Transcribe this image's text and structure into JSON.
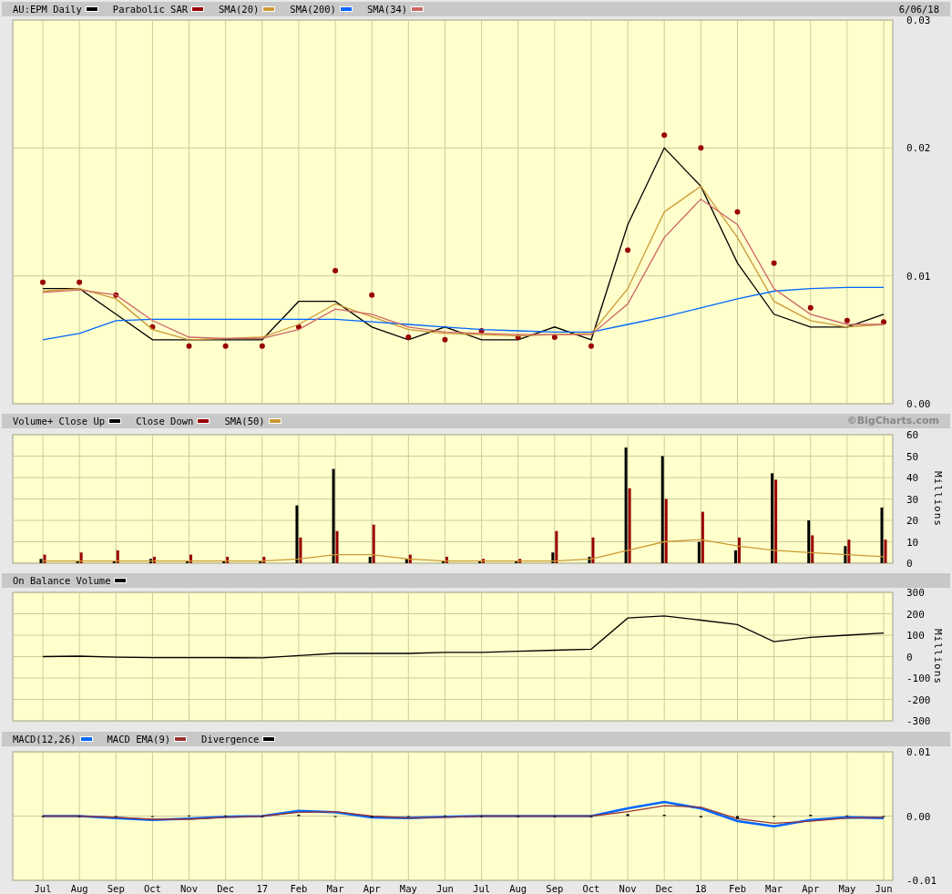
{
  "panels": [
    {
      "header_right": "6/06/18",
      "chart_data": {
        "type": "line",
        "grid": true,
        "ylim": [
          0,
          0.03
        ],
        "yticks": [
          {
            "value": 0,
            "label": "0.00"
          },
          {
            "value": 0.01,
            "label": "0.01"
          },
          {
            "value": 0.02,
            "label": "0.02"
          },
          {
            "value": 0.03,
            "label": "0.03"
          }
        ],
        "series": [
          {
            "name": "AU:EPM Daily",
            "color": "#000000",
            "values": [
              0.009,
              0.009,
              0.007,
              0.005,
              0.005,
              0.005,
              0.005,
              0.008,
              0.008,
              0.006,
              0.005,
              0.006,
              0.005,
              0.005,
              0.006,
              0.005,
              0.014,
              0.02,
              0.017,
              0.011,
              0.007,
              0.006,
              0.006,
              0.007
            ]
          },
          {
            "name": "Parabolic SAR",
            "color": "#990000",
            "type": "scatter",
            "values": [
              0.0095,
              0.0095,
              0.0085,
              0.006,
              0.0045,
              0.0045,
              0.0045,
              0.006,
              0.0104,
              0.0085,
              0.0052,
              0.005,
              0.0057,
              0.0052,
              0.0052,
              0.0045,
              0.012,
              0.021,
              0.02,
              0.015,
              0.011,
              0.0075,
              0.0065,
              0.0064
            ]
          },
          {
            "name": "SMA(20)",
            "color": "#cc9933",
            "values": [
              0.0088,
              0.009,
              0.0082,
              0.0058,
              0.005,
              0.0051,
              0.0052,
              0.0062,
              0.0078,
              0.0068,
              0.0058,
              0.0055,
              0.0054,
              0.0053,
              0.0054,
              0.0055,
              0.009,
              0.015,
              0.017,
              0.013,
              0.008,
              0.0065,
              0.006,
              0.0062
            ]
          },
          {
            "name": "SMA(200)",
            "color": "#0066ff",
            "values": [
              0.005,
              0.0055,
              0.0065,
              0.0066,
              0.0066,
              0.0066,
              0.0066,
              0.0066,
              0.0066,
              0.0064,
              0.0062,
              0.006,
              0.0058,
              0.0057,
              0.0056,
              0.0056,
              0.0062,
              0.0068,
              0.0075,
              0.0082,
              0.0088,
              0.009,
              0.0091,
              0.0091
            ]
          },
          {
            "name": "SMA(34)",
            "color": "#cc6666",
            "values": [
              0.0087,
              0.0089,
              0.0085,
              0.0065,
              0.0052,
              0.0051,
              0.0051,
              0.0058,
              0.0074,
              0.007,
              0.006,
              0.0056,
              0.0055,
              0.0054,
              0.0054,
              0.0054,
              0.0078,
              0.013,
              0.016,
              0.014,
              0.009,
              0.007,
              0.0062,
              0.0062
            ]
          }
        ]
      }
    },
    {
      "header_right": "©BigCharts.com",
      "chart_data": {
        "type": "bar",
        "grid": true,
        "ylabel": "Millions",
        "ylim": [
          0,
          60
        ],
        "yticks": [
          {
            "value": 0,
            "label": "0"
          },
          {
            "value": 10,
            "label": "10"
          },
          {
            "value": 20,
            "label": "20"
          },
          {
            "value": 30,
            "label": "30"
          },
          {
            "value": 40,
            "label": "40"
          },
          {
            "value": 50,
            "label": "50"
          },
          {
            "value": 60,
            "label": "60"
          }
        ],
        "series": [
          {
            "name": "Volume+ Close Up",
            "color": "#000000",
            "values": [
              2,
              1,
              1,
              2,
              1,
              1,
              1,
              27,
              44,
              3,
              2,
              1,
              1,
              1,
              5,
              3,
              54,
              50,
              10,
              6,
              42,
              20,
              8,
              26
            ]
          },
          {
            "name": "Close Down",
            "color": "#990000",
            "values": [
              4,
              5,
              6,
              3,
              4,
              3,
              3,
              12,
              15,
              18,
              4,
              3,
              2,
              2,
              15,
              12,
              35,
              30,
              24,
              12,
              39,
              13,
              11,
              11
            ]
          },
          {
            "name": "SMA(50)",
            "color": "#cc9933",
            "type": "line",
            "values": [
              1,
              1,
              1,
              1,
              1,
              1,
              1,
              2,
              4,
              4,
              2,
              1,
              1,
              1,
              1,
              2,
              6,
              10,
              11,
              8,
              6,
              5,
              4,
              3
            ]
          }
        ]
      }
    },
    {
      "chart_data": {
        "type": "line",
        "grid": true,
        "ylabel": "Millions",
        "ylim": [
          -300,
          300
        ],
        "yticks": [
          {
            "value": 300,
            "label": "300"
          },
          {
            "value": 200,
            "label": "200"
          },
          {
            "value": 100,
            "label": "100"
          },
          {
            "value": 0,
            "label": "0"
          },
          {
            "value": -100,
            "label": "-100"
          },
          {
            "value": -200,
            "label": "-200"
          },
          {
            "value": -300,
            "label": "-300"
          }
        ],
        "series": [
          {
            "name": "On Balance Volume",
            "color": "#000000",
            "values": [
              0,
              2,
              -3,
              -5,
              -5,
              -5,
              -6,
              5,
              15,
              15,
              15,
              20,
              20,
              25,
              30,
              35,
              180,
              190,
              170,
              150,
              70,
              90,
              100,
              110
            ]
          }
        ]
      }
    },
    {
      "chart_data": {
        "type": "line",
        "grid": true,
        "categories": [
          "Jul",
          "Aug",
          "Sep",
          "Oct",
          "Nov",
          "Dec",
          "17",
          "Feb",
          "Mar",
          "Apr",
          "May",
          "Jun",
          "Jul",
          "Aug",
          "Sep",
          "Oct",
          "Nov",
          "Dec",
          "18",
          "Feb",
          "Mar",
          "Apr",
          "May",
          "Jun"
        ],
        "ylim": [
          -0.01,
          0.01
        ],
        "yticks": [
          {
            "value": 0.01,
            "label": "0.01"
          },
          {
            "value": 0,
            "label": "0.00"
          },
          {
            "value": -0.01,
            "label": "-0.01"
          }
        ],
        "series": [
          {
            "name": "MACD(12,26)",
            "color": "#0066ff",
            "values": [
              0,
              0,
              -0.0003,
              -0.0006,
              -0.0004,
              -0.0001,
              0,
              0.0008,
              0.0006,
              -0.0002,
              -0.0003,
              -0.0001,
              0,
              0,
              0,
              0,
              0.0012,
              0.0022,
              0.0012,
              -0.0008,
              -0.0016,
              -0.0006,
              -0.0002,
              -0.0003
            ]
          },
          {
            "name": "MACD EMA(9)",
            "color": "#993333",
            "values": [
              0,
              0,
              -0.0002,
              -0.0005,
              -0.0005,
              -0.0002,
              0,
              0.0006,
              0.0007,
              0,
              -0.0003,
              -0.0002,
              0,
              0,
              0,
              0,
              0.0007,
              0.0016,
              0.0014,
              -0.0004,
              -0.0011,
              -0.0008,
              -0.0003,
              -0.0002
            ]
          },
          {
            "name": "Divergence",
            "color": "#000000",
            "type": "bar",
            "values": [
              0,
              0,
              -0.0001,
              -0.0001,
              0.0001,
              0.0001,
              0,
              0.0002,
              -0.0001,
              -0.0002,
              0,
              0.0001,
              0,
              0,
              0,
              0,
              0.0003,
              0.0002,
              -0.0002,
              -0.0004,
              -0.0001,
              0.0002,
              0.0001,
              -0.0001
            ]
          }
        ]
      }
    }
  ]
}
